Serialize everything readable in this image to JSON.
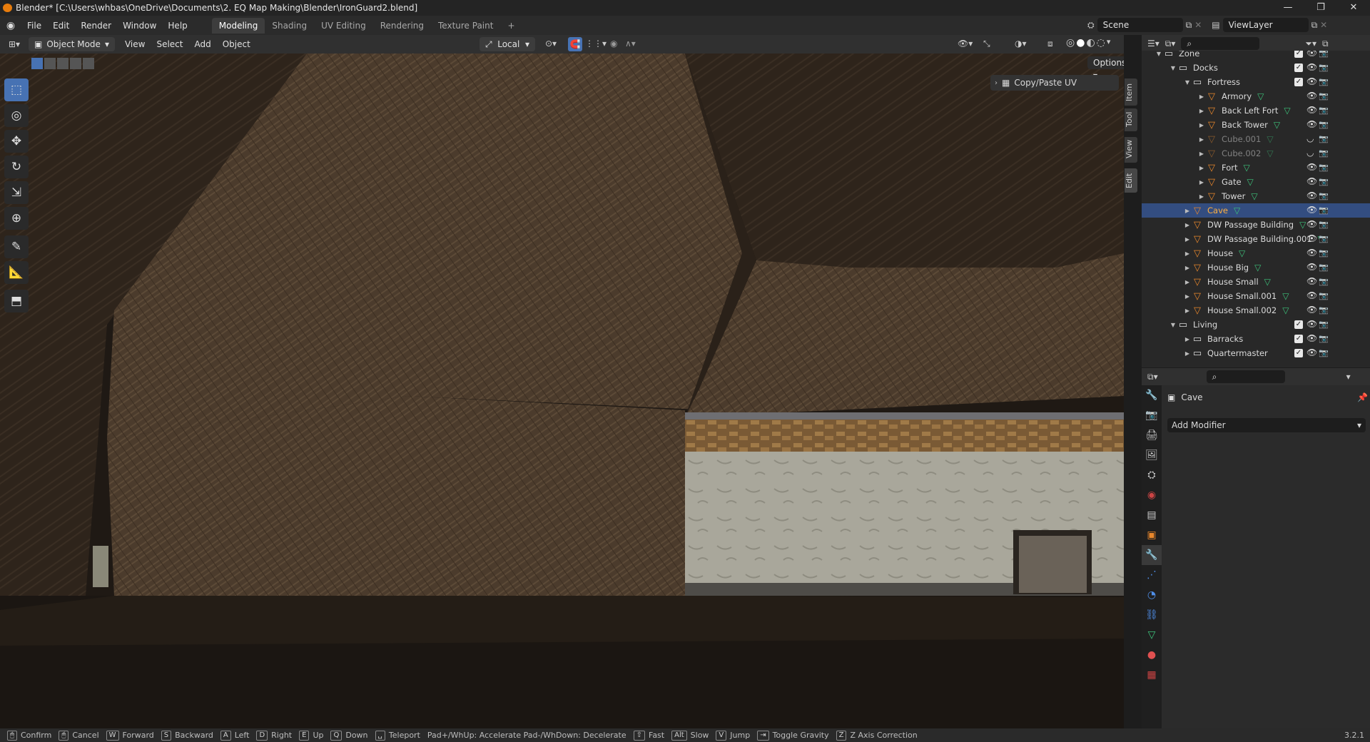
{
  "window": {
    "title": "Blender* [C:\\Users\\whbas\\OneDrive\\Documents\\2. EQ Map Making\\Blender\\IronGuard2.blend]"
  },
  "menu": [
    "File",
    "Edit",
    "Render",
    "Window",
    "Help"
  ],
  "workspaces": [
    "Modeling",
    "Shading",
    "UV Editing",
    "Rendering",
    "Texture Paint",
    "+"
  ],
  "scene": {
    "name": "Scene",
    "view_layer": "ViewLayer"
  },
  "viewport_header": {
    "mode": "Object Mode",
    "menus": [
      "View",
      "Select",
      "Add",
      "Object"
    ],
    "orientation": "Local",
    "options": "Options"
  },
  "side_panel": {
    "tabs": [
      "Item",
      "Tool",
      "View",
      "Edit"
    ],
    "copy_paste_uv": "Copy/Paste UV"
  },
  "outliner": {
    "items": [
      {
        "label": "Zone",
        "level": 0,
        "type": "collection"
      },
      {
        "label": "Docks",
        "level": 1,
        "type": "collection"
      },
      {
        "label": "Fortress",
        "level": 2,
        "type": "collection"
      },
      {
        "label": "Armory",
        "level": 3,
        "type": "mesh"
      },
      {
        "label": "Back Left Fort",
        "level": 3,
        "type": "mesh"
      },
      {
        "label": "Back Tower",
        "level": 3,
        "type": "mesh"
      },
      {
        "label": "Cube.001",
        "level": 3,
        "type": "mesh",
        "hidden": true
      },
      {
        "label": "Cube.002",
        "level": 3,
        "type": "mesh",
        "hidden": true
      },
      {
        "label": "Fort",
        "level": 3,
        "type": "mesh"
      },
      {
        "label": "Gate",
        "level": 3,
        "type": "mesh"
      },
      {
        "label": "Tower",
        "level": 3,
        "type": "mesh"
      },
      {
        "label": "Cave",
        "level": 2,
        "type": "mesh",
        "selected": true
      },
      {
        "label": "DW Passage Building",
        "level": 2,
        "type": "mesh"
      },
      {
        "label": "DW Passage Building.001",
        "level": 2,
        "type": "mesh"
      },
      {
        "label": "House",
        "level": 2,
        "type": "mesh"
      },
      {
        "label": "House Big",
        "level": 2,
        "type": "mesh"
      },
      {
        "label": "House Small",
        "level": 2,
        "type": "mesh"
      },
      {
        "label": "House Small.001",
        "level": 2,
        "type": "mesh"
      },
      {
        "label": "House Small.002",
        "level": 2,
        "type": "mesh"
      },
      {
        "label": "Living",
        "level": 1,
        "type": "collection"
      },
      {
        "label": "Barracks",
        "level": 2,
        "type": "collection"
      },
      {
        "label": "Quartermaster",
        "level": 2,
        "type": "collection"
      }
    ]
  },
  "properties": {
    "object_name": "Cave",
    "add_modifier": "Add Modifier"
  },
  "statusbar": {
    "items": [
      {
        "key": "🖱",
        "label": "Confirm"
      },
      {
        "key": "🖱",
        "label": "Cancel"
      },
      {
        "key": "W",
        "label": "Forward"
      },
      {
        "key": "S",
        "label": "Backward"
      },
      {
        "key": "A",
        "label": "Left"
      },
      {
        "key": "D",
        "label": "Right"
      },
      {
        "key": "E",
        "label": "Up"
      },
      {
        "key": "Q",
        "label": "Down"
      },
      {
        "key": "␣",
        "label": "Teleport"
      },
      {
        "key": "",
        "label": "Pad+/WhUp: Accelerate Pad-/WhDown: Decelerate"
      },
      {
        "key": "⇧",
        "label": "Fast"
      },
      {
        "key": "Alt",
        "label": "Slow"
      },
      {
        "key": "V",
        "label": "Jump"
      },
      {
        "key": "⇥",
        "label": "Toggle Gravity"
      },
      {
        "key": "Z",
        "label": "Z Axis Correction"
      }
    ],
    "version": "3.2.1"
  },
  "icons": [
    "blender-logo-icon",
    "select-box-icon",
    "cursor-icon",
    "move-icon",
    "rotate-icon",
    "scale-icon",
    "transform-icon",
    "annotate-icon",
    "measure-icon",
    "add-cube-icon",
    "eye-icon",
    "camera-icon",
    "mesh-icon",
    "collection-icon",
    "wrench-icon"
  ],
  "colors": {
    "accent": "#4772b3",
    "selection": "#334d80",
    "mesh_green": "#3dc27b",
    "object_orange": "#e8872c"
  }
}
